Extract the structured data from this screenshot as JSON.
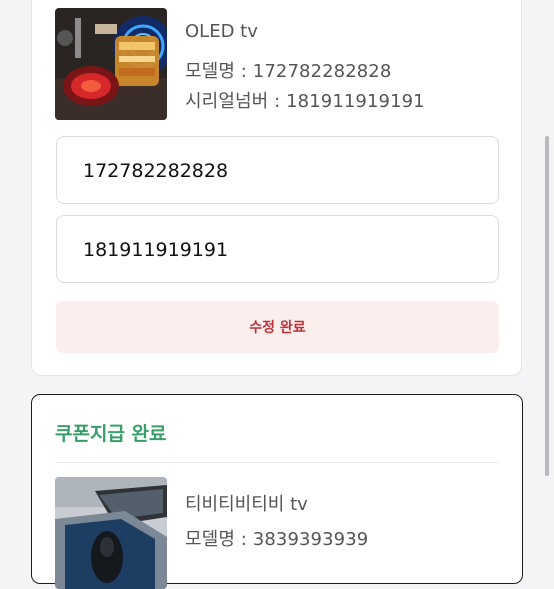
{
  "card1": {
    "product_name": "OLED tv",
    "model_line": "모델명 : 172782282828",
    "serial_line": "시리얼넘버 : 181911919191",
    "model_input_value": "172782282828",
    "serial_input_value": "181911919191",
    "submit_label": "수정 완료"
  },
  "card2": {
    "status_label": "쿠폰지급 완료",
    "product_name": "티비티비티비 tv",
    "model_line": "모델명 : 3839393939",
    "status_color": "#3a9e6a"
  },
  "colors": {
    "accent_red": "#b8333a",
    "button_bg": "#fdeeee"
  }
}
